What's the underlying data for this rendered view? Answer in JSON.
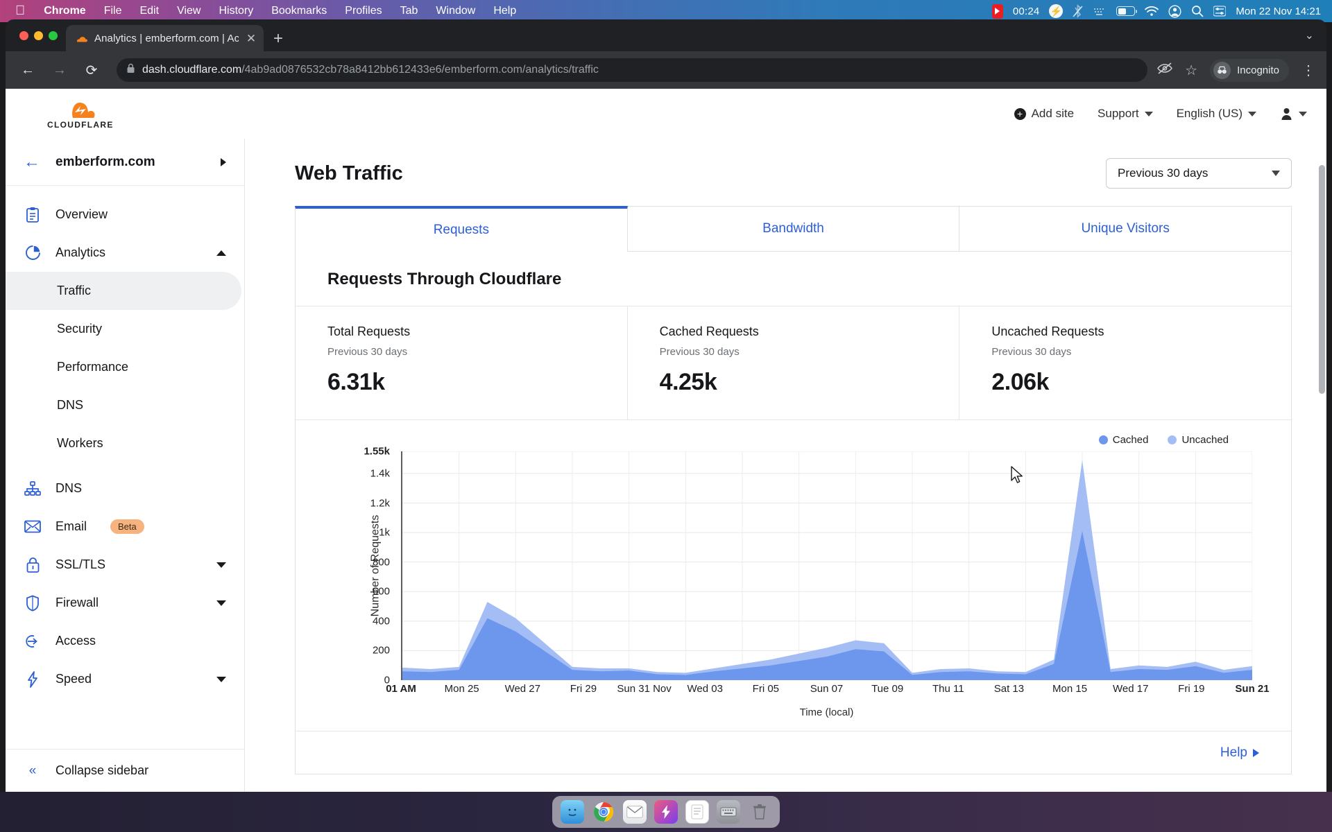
{
  "menubar": {
    "apple_icon": "apple-icon",
    "items": [
      {
        "label": "Chrome",
        "bold": true
      },
      {
        "label": "File",
        "bold": false
      },
      {
        "label": "Edit",
        "bold": false
      },
      {
        "label": "View",
        "bold": false
      },
      {
        "label": "History",
        "bold": false
      },
      {
        "label": "Bookmarks",
        "bold": false
      },
      {
        "label": "Profiles",
        "bold": false
      },
      {
        "label": "Tab",
        "bold": false
      },
      {
        "label": "Window",
        "bold": false
      },
      {
        "label": "Help",
        "bold": false
      }
    ],
    "recording_time": "00:24",
    "status_icons": [
      "screen-recording-icon",
      "bolt-icon",
      "bluetooth-off-icon",
      "keyboard-icon",
      "battery-icon",
      "wifi-icon",
      "account-icon",
      "spotlight-search-icon",
      "control-center-icon"
    ],
    "clock": "Mon 22 Nov  14:21"
  },
  "browser": {
    "tab_title": "Analytics | emberform.com | Ac",
    "tab_close_label": "✕",
    "new_tab_label": "+",
    "tabstrip_menu_label": "⌄",
    "back_label": "←",
    "forward_label": "→",
    "reload_label": "⟳",
    "url_domain": "dash.cloudflare.com",
    "url_path": "/4ab9ad0876532cb78a8412bb612433e6/emberform.com/analytics/traffic",
    "profile_label": "Incognito",
    "menu_label": "⋮",
    "bookmark_label": "☆",
    "tracking_label": "⌾"
  },
  "cf_header": {
    "brand": "CLOUDFLARE",
    "add_site": "Add site",
    "support": "Support",
    "language": "English (US)"
  },
  "sidebar": {
    "site_name": "emberform.com",
    "items": [
      {
        "label": "Overview",
        "icon": "clipboard-icon",
        "expandable": false
      },
      {
        "label": "Analytics",
        "icon": "pie-chart-icon",
        "expandable": true,
        "expanded": true
      },
      {
        "label": "DNS",
        "icon": "sitemap-icon",
        "expandable": false
      },
      {
        "label": "Email",
        "icon": "envelope-icon",
        "expandable": false,
        "badge": "Beta"
      },
      {
        "label": "SSL/TLS",
        "icon": "lock-icon",
        "expandable": true
      },
      {
        "label": "Firewall",
        "icon": "shield-icon",
        "expandable": true
      },
      {
        "label": "Access",
        "icon": "login-arrow-icon",
        "expandable": false
      },
      {
        "label": "Speed",
        "icon": "bolt-icon",
        "expandable": true
      }
    ],
    "analytics_subitems": [
      {
        "label": "Traffic",
        "active": true
      },
      {
        "label": "Security",
        "active": false
      },
      {
        "label": "Performance",
        "active": false
      },
      {
        "label": "DNS",
        "active": false
      },
      {
        "label": "Workers",
        "active": false
      }
    ],
    "collapse_label": "Collapse sidebar"
  },
  "main": {
    "page_title": "Web Traffic",
    "date_range": "Previous 30 days",
    "tabs": [
      {
        "label": "Requests",
        "active": true
      },
      {
        "label": "Bandwidth",
        "active": false
      },
      {
        "label": "Unique Visitors",
        "active": false
      }
    ],
    "card_title": "Requests Through Cloudflare",
    "stats": [
      {
        "label": "Total Requests",
        "sub": "Previous 30 days",
        "value": "6.31k"
      },
      {
        "label": "Cached Requests",
        "sub": "Previous 30 days",
        "value": "4.25k"
      },
      {
        "label": "Uncached Requests",
        "sub": "Previous 30 days",
        "value": "2.06k"
      }
    ],
    "help_label": "Help"
  },
  "chart_data": {
    "type": "area",
    "title": "Requests Through Cloudflare",
    "xlabel": "Time (local)",
    "ylabel": "Number of Requests",
    "ylim": [
      0,
      1550
    ],
    "yticks": [
      "0",
      "200",
      "400",
      "600",
      "800",
      "1k",
      "1.2k",
      "1.4k",
      "1.55k"
    ],
    "ytick_values": [
      0,
      200,
      400,
      600,
      800,
      1000,
      1200,
      1400,
      1550
    ],
    "grid": true,
    "legend_position": "top-right",
    "stacked": true,
    "colors": {
      "cached": "#6c97ec",
      "uncached": "#a4bef5"
    },
    "legend": [
      "Cached",
      "Uncached"
    ],
    "xticks": [
      "01 AM",
      "Mon 25",
      "Wed 27",
      "Fri 29",
      "Sun 31 Nov",
      "Wed 03",
      "Fri 05",
      "Sun 07",
      "Tue 09",
      "Thu 11",
      "Sat 13",
      "Mon 15",
      "Wed 17",
      "Fri 19",
      "Sun 21"
    ],
    "x": [
      "Nov 22 01 AM",
      "Nov 23",
      "Nov 24",
      "Mon 25",
      "Nov 26",
      "Wed 27",
      "Nov 28",
      "Fri 29",
      "Nov 30",
      "Sun 31 Nov",
      "Nov 01",
      "Nov 02",
      "Wed 03",
      "Nov 04",
      "Fri 05",
      "Nov 06",
      "Sun 07",
      "Nov 08",
      "Tue 09",
      "Nov 10",
      "Thu 11",
      "Nov 12",
      "Sat 13",
      "Nov 14",
      "Mon 15",
      "Nov 16",
      "Wed 17",
      "Nov 18",
      "Fri 19",
      "Nov 20",
      "Sun 21"
    ],
    "series": [
      {
        "name": "Cached",
        "values": [
          60,
          55,
          70,
          420,
          330,
          200,
          70,
          60,
          65,
          40,
          35,
          60,
          80,
          100,
          130,
          160,
          210,
          195,
          35,
          55,
          60,
          45,
          40,
          110,
          1010,
          55,
          75,
          70,
          95,
          50,
          70
        ]
      },
      {
        "name": "Uncached",
        "values": [
          25,
          20,
          20,
          110,
          90,
          55,
          20,
          20,
          15,
          15,
          15,
          20,
          30,
          40,
          50,
          60,
          60,
          55,
          15,
          20,
          20,
          15,
          15,
          30,
          480,
          20,
          25,
          20,
          30,
          20,
          25
        ]
      }
    ]
  },
  "dock": {
    "items": [
      "finder-icon",
      "chrome-icon",
      "mail-icon",
      "shortcuts-icon",
      "notes-icon",
      "keyboard-icon",
      "trash-icon"
    ]
  }
}
